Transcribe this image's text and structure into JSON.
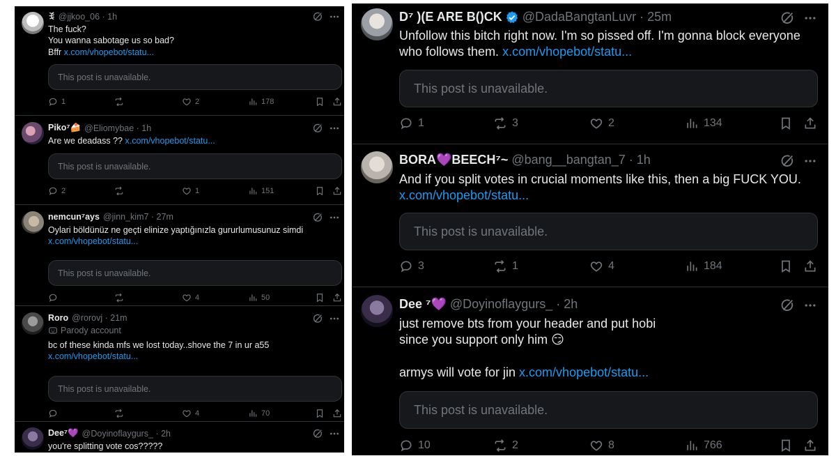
{
  "left_feed": [
    {
      "name": "ꉂ",
      "handle": "@jjkoo_06 · 1h",
      "text": "The fuck?\nYou wanna sabotage us so bad?\nBffr ",
      "link": "x.com/vhopebot/statu...",
      "unavailable": "This post is unavailable.",
      "replies": "1",
      "reposts": "",
      "likes": "2",
      "views": "178",
      "avatar_color": "#d9d9d9"
    },
    {
      "name": "Piko⁷🍰",
      "handle": "@Eliomybae · 1h",
      "text": "Are we deadass ?? ",
      "link": "x.com/vhopebot/statu...",
      "unavailable": "This post is unavailable.",
      "replies": "2",
      "reposts": "",
      "likes": "1",
      "views": "151",
      "avatar_color": "#6b4a6e"
    },
    {
      "name": "nemcun⁷ays",
      "handle": "@jinn_kim7 · 27m",
      "text": "Oylari böldünüz ne geçti elinize yaptığınızla gururlumusunuz simdi\n",
      "link": "x.com/vhopebot/statu...",
      "unavailable": "This post is unavailable.",
      "replies": "",
      "reposts": "",
      "likes": "4",
      "views": "50",
      "avatar_color": "#8a8478"
    },
    {
      "name": "Roro",
      "handle": "@rorovj · 21m",
      "parody": "Parody account",
      "text": "bc of these kinda mfs we lost today..shove the 7 in ur a55\n",
      "link": "x.com/vhopebot/statu...",
      "unavailable": "This post is unavailable.",
      "replies": "",
      "reposts": "",
      "likes": "4",
      "views": "70",
      "avatar_color": "#4a4a4a"
    },
    {
      "name": "Dee⁷💜",
      "handle": "@Doyinoflaygurs_ · 2h",
      "text": "you're splitting vote cos?????",
      "avatar_color": "#3a2d4a"
    }
  ],
  "right_feed": [
    {
      "name": "D⁷ )(E ARE B()CK",
      "handle": "@DadaBangtanLuvr · 25m",
      "verified": true,
      "text": "Unfollow this bitch right now. I'm so pissed off. I'm gonna block everyone\nwho follows them. ",
      "link": "x.com/vhopebot/statu...",
      "unavailable": "This post is unavailable.",
      "replies": "1",
      "reposts": "3",
      "likes": "2",
      "views": "134",
      "avatar_color": "#9aa0a6"
    },
    {
      "name": "BORA💜BEECH⁷~",
      "handle": "@bang__bangtan_7 · 1h",
      "text": "And if you split votes in crucial moments like this, then a big FUCK YOU.\n",
      "link": "x.com/vhopebot/statu...",
      "unavailable": "This post is unavailable.",
      "replies": "3",
      "reposts": "1",
      "likes": "4",
      "views": "184",
      "avatar_color": "#b9b3ad"
    },
    {
      "name": "Dee ⁷💜",
      "handle": "@Doyinoflaygurs_ · 2h",
      "text": "just remove bts from your header and put hobi\nsince you support only him 😏\n\narmys will vote for jin ",
      "link": "x.com/vhopebot/statu...",
      "unavailable": "This post is unavailable.",
      "replies": "10",
      "reposts": "2",
      "likes": "8",
      "views": "766",
      "avatar_color": "#3a2d4a"
    }
  ],
  "colors": {
    "background": "#000000",
    "text": "#e7e9ea",
    "muted": "#71767b",
    "link": "#1d9bf0",
    "card": "#16181c",
    "border": "#2f3336"
  }
}
